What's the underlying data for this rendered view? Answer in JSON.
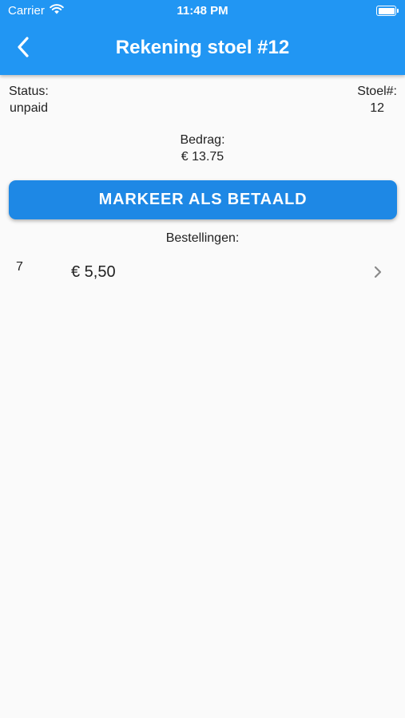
{
  "status_bar": {
    "carrier": "Carrier",
    "time": "11:48 PM"
  },
  "nav": {
    "title": "Rekening stoel #12",
    "back_icon": "chevron-left-icon"
  },
  "bill": {
    "status_label": "Status:",
    "status_value": "unpaid",
    "seat_label": "Stoel#:",
    "seat_value": "12",
    "amount_label": "Bedrag:",
    "amount_value": "€ 13.75"
  },
  "actions": {
    "mark_paid_label": "MARKEER ALS BETAALD"
  },
  "orders": {
    "heading": "Bestellingen:",
    "items": [
      {
        "quantity": "7",
        "price": "€ 5,50"
      }
    ]
  },
  "colors": {
    "app_bar": "#2196f3",
    "primary_button": "#1e88e5",
    "background": "#fafafa"
  }
}
